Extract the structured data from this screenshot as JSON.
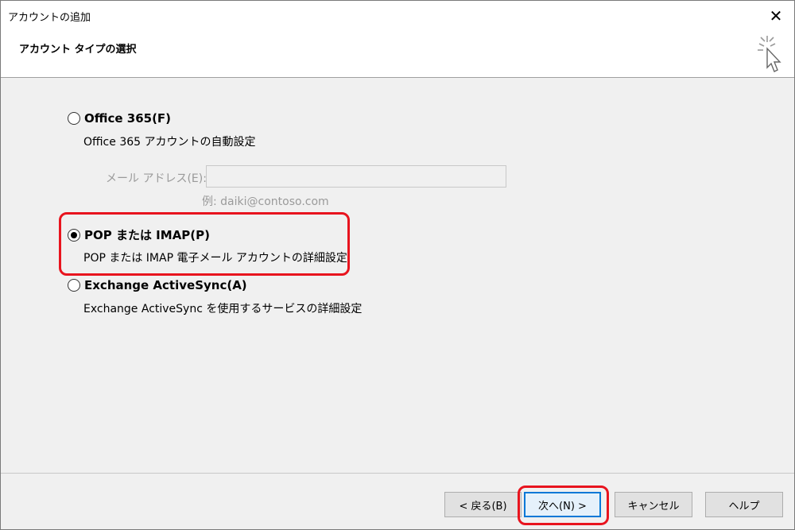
{
  "window": {
    "title": "アカウントの追加",
    "close_glyph": "✕"
  },
  "header": {
    "page_title": "アカウント タイプの選択"
  },
  "options": {
    "office365": {
      "label": "Office 365(F)",
      "description": "Office 365 アカウントの自動設定",
      "selected": false
    },
    "email": {
      "label": "メール アドレス(E):",
      "value": "",
      "example": "例: daiki@contoso.com"
    },
    "pop_imap": {
      "label": "POP または IMAP(P)",
      "description": "POP または IMAP 電子メール アカウントの詳細設定",
      "selected": true
    },
    "exchange": {
      "label": "Exchange ActiveSync(A)",
      "description": "Exchange ActiveSync を使用するサービスの詳細設定",
      "selected": false
    }
  },
  "footer": {
    "back_label": "< 戻る(B)",
    "next_label": "次へ(N) >",
    "cancel_label": "キャンセル",
    "help_label": "ヘルプ"
  },
  "colors": {
    "highlight": "#e8141e",
    "focus": "#0078d7"
  },
  "icons": {
    "wizard": "wizard-cursor-icon",
    "close": "close-icon"
  }
}
